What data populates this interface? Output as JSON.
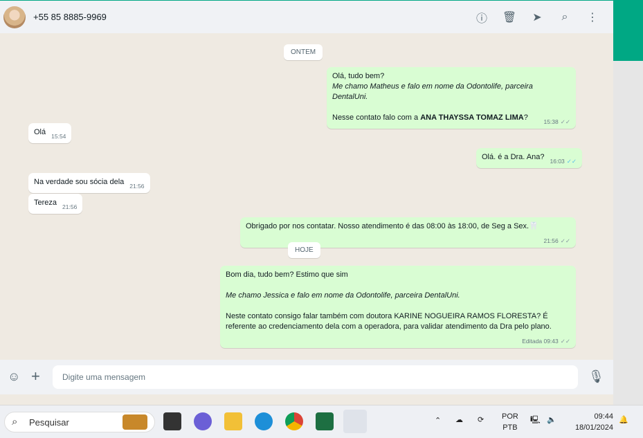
{
  "header": {
    "contact": "+55 85 8885-9969",
    "icons": [
      "info-icon",
      "trash-icon",
      "label-icon",
      "search-icon",
      "more-icon"
    ]
  },
  "days": {
    "yesterday": "ONTEM",
    "today": "HOJE"
  },
  "messages": [
    {
      "dir": "out",
      "line1": "Olá, tudo bem?",
      "line2": "Me chamo Matheus e falo em nome da Odontolife, parceira DentalUni.",
      "line3a": "Nesse contato falo com a ",
      "line3b": "ANA THAYSSA TOMAZ LIMA",
      "line3c": "?",
      "time": "15:38"
    },
    {
      "dir": "in",
      "text": "Olá",
      "time": "15:54"
    },
    {
      "dir": "out",
      "text": "Olá. é a Dra. Ana?",
      "time": "16:03"
    },
    {
      "dir": "in",
      "text": "Na verdade sou sócia dela",
      "time": "21:56"
    },
    {
      "dir": "in",
      "text": "Tereza",
      "time": "21:56"
    },
    {
      "dir": "out",
      "text": "Obrigado por nos contatar. Nosso atendimento é das 08:00 às 18:00, de Seg a Sex.🦷",
      "time": "21:56"
    },
    {
      "dir": "out",
      "line1": "Bom dia, tudo bem? Estimo que sim",
      "line2": "Me chamo Jessica e falo em nome da Odontolife, parceira DentalUni.",
      "line3": "Neste contato consigo falar também com doutora  KARINE NOGUEIRA RAMOS FLORESTA? É referente ao credenciamento dela com a operadora, para validar atendimento da Dra pelo plano.",
      "edited": "Editada",
      "time": "09:43"
    }
  ],
  "footer": {
    "placeholder": "Digite uma mensagem"
  },
  "taskbar": {
    "search": "Pesquisar",
    "lang1": "POR",
    "lang2": "PTB",
    "time": "09:44",
    "date": "18/01/2024"
  },
  "colors": {
    "accent": "#00a884",
    "outgoing": "#d9fdd3"
  }
}
